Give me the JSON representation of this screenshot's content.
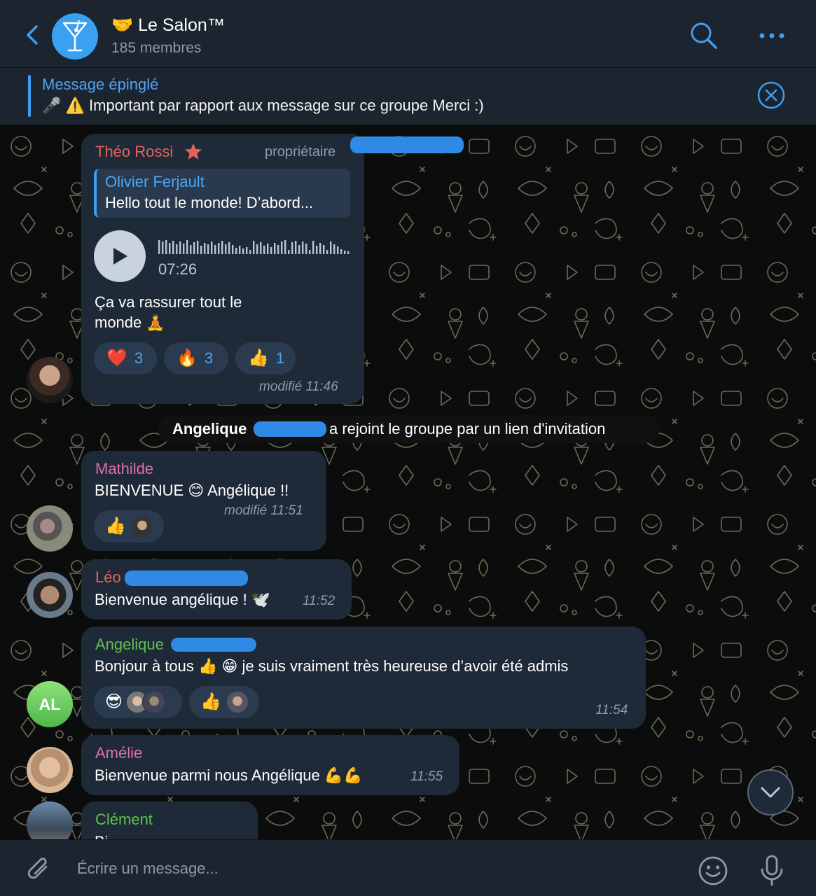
{
  "header": {
    "title": "🤝 Le Salon™",
    "subtitle": "185 membres",
    "avatar_icon": "cocktail-glass-icon"
  },
  "pinned": {
    "title": "Message épinglé",
    "text": "🎤 ⚠️ Important par rapport aux message sur ce groupe    Merci :)"
  },
  "messages": {
    "theo": {
      "sender": "Théo Rossi",
      "sender_badge": "star-icon",
      "role": "propriétaire",
      "reply_author": "Olivier Ferjault",
      "reply_text": "Hello tout le monde! D’abord...",
      "voice_duration": "07:26",
      "text_line1": "Ça va rassurer tout le",
      "text_line2": "monde 🧘",
      "reactions": [
        {
          "emoji": "❤️",
          "count": "3"
        },
        {
          "emoji": "🔥",
          "count": "3"
        },
        {
          "emoji": "👍",
          "count": "1"
        }
      ],
      "time": "modifié 11:46"
    },
    "service": {
      "name": "Angelique",
      "text": "a rejoint le groupe par un lien d'invitation"
    },
    "mathilde": {
      "sender": "Mathilde",
      "text": "BIENVENUE 😊  Angélique !!",
      "reaction_emoji": "👍",
      "time": "modifié 11:51"
    },
    "leo": {
      "sender": "Léo",
      "text": "Bienvenue angélique ! 🕊️",
      "time": "11:52"
    },
    "angelique": {
      "sender": "Angelique",
      "avatar_initials": "AL",
      "text": "Bonjour à tous 👍 😁  je suis vraiment très heureuse d’avoir été admis",
      "reaction1_emoji": "😎",
      "reaction2_emoji": "👍",
      "time": "11:54"
    },
    "amelie": {
      "sender": "Amélie",
      "text": "Bienvenue parmi nous Angélique 💪💪",
      "time": "11:55"
    },
    "clement": {
      "sender": "Clément",
      "text": "Bi"
    }
  },
  "input": {
    "placeholder": "Écrire un message..."
  },
  "colors": {
    "accent": "#3e9ef2",
    "bubble": "#1e2a38",
    "header": "#1c2430",
    "theo": "#e8605a",
    "mathilde": "#e06fa6",
    "leo": "#e8605a",
    "angelique": "#5cc24b",
    "amelie": "#e06fa6",
    "clement": "#5cc24b"
  }
}
